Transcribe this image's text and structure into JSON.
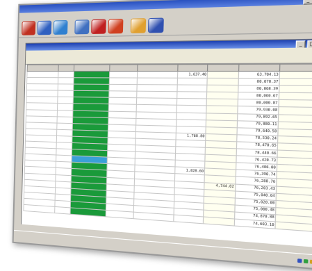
{
  "window": {
    "title": "",
    "controls": [
      "_",
      "□",
      "×"
    ]
  },
  "menubar": {
    "items": []
  },
  "toolbar": {
    "icons": [
      {
        "name": "app-icon",
        "color": "#c03020"
      },
      {
        "name": "document-icon",
        "color": "#3060c0"
      },
      {
        "name": "refresh-icon",
        "color": "#3080d0"
      },
      {
        "name": "report-icon",
        "color": "#4070c0"
      },
      {
        "name": "tools-icon",
        "color": "#c02020"
      },
      {
        "name": "stop-icon",
        "color": "#d04020"
      },
      {
        "name": "edit-icon",
        "color": "#e0a030"
      },
      {
        "name": "help-icon",
        "color": "#3050b0"
      }
    ]
  },
  "child_window": {
    "title": "",
    "menu": [],
    "toolbar": []
  },
  "table": {
    "columns": [
      "",
      "",
      "",
      "",
      "",
      "",
      "",
      "",
      ""
    ],
    "rows": [
      {
        "date": "",
        "code": "",
        "g": "",
        "d2": "",
        "desc": "",
        "amt": "1,637.40",
        "a2": "",
        "bal": "63,704.13",
        "x": ""
      },
      {
        "date": "",
        "code": "",
        "g": "",
        "d2": "",
        "desc": "",
        "amt": "",
        "a2": "",
        "bal": "80,078.37",
        "x": ""
      },
      {
        "date": "",
        "code": "",
        "g": "",
        "d2": "",
        "desc": "",
        "amt": "",
        "a2": "",
        "bal": "80,068.39",
        "x": ""
      },
      {
        "date": "",
        "code": "",
        "g": "",
        "d2": "",
        "desc": "",
        "amt": "",
        "a2": "",
        "bal": "80,060.67",
        "x": ""
      },
      {
        "date": "",
        "code": "",
        "g": "",
        "d2": "",
        "desc": "",
        "amt": "",
        "a2": "",
        "bal": "80,000.87",
        "x": ""
      },
      {
        "date": "",
        "code": "",
        "g": "",
        "d2": "",
        "desc": "",
        "amt": "",
        "a2": "",
        "bal": "79,930.08",
        "x": ""
      },
      {
        "date": "",
        "code": "",
        "g": "",
        "d2": "",
        "desc": "",
        "amt": "",
        "a2": "",
        "bal": "79,892.65",
        "x": ""
      },
      {
        "date": "",
        "code": "",
        "g": "",
        "d2": "",
        "desc": "",
        "amt": "",
        "a2": "",
        "bal": "79,880.11",
        "x": ""
      },
      {
        "date": "",
        "code": "",
        "g": "",
        "d2": "",
        "desc": "",
        "amt": "",
        "a2": "",
        "bal": "79,640.58",
        "x": ""
      },
      {
        "date": "",
        "code": "",
        "g": "",
        "d2": "",
        "desc": "",
        "amt": "1,768.80",
        "a2": "",
        "bal": "78,530.24",
        "x": ""
      },
      {
        "date": "",
        "code": "",
        "g": "",
        "d2": "",
        "desc": "",
        "amt": "",
        "a2": "",
        "bal": "78,470.65",
        "x": ""
      },
      {
        "date": "",
        "code": "",
        "g": "",
        "d2": "",
        "desc": "",
        "amt": "",
        "a2": "",
        "bal": "78,440.66",
        "x": ""
      },
      {
        "date": "",
        "code": "",
        "g": "",
        "d2": "",
        "desc": "",
        "amt": "",
        "a2": "",
        "bal": "76,420.73",
        "x": ""
      },
      {
        "date": "",
        "code": "",
        "g": "",
        "d2": "",
        "desc": "",
        "amt": "",
        "a2": "",
        "bal": "76,406.00",
        "x": ""
      },
      {
        "date": "",
        "code": "",
        "g": "",
        "d2": "",
        "desc": "",
        "amt": "1,828.60",
        "a2": "",
        "bal": "76,390.74",
        "x": ""
      },
      {
        "date": "",
        "code": "",
        "g": "",
        "d2": "",
        "desc": "",
        "amt": "",
        "a2": "",
        "bal": "76,288.76",
        "x": ""
      },
      {
        "date": "",
        "code": "",
        "g": "",
        "d2": "",
        "desc": "",
        "amt": "",
        "a2": "4,744.02",
        "bal": "76,203.43",
        "x": ""
      },
      {
        "date": "",
        "code": "",
        "g": "",
        "d2": "",
        "desc": "",
        "amt": "",
        "a2": "",
        "bal": "75,040.04",
        "x": ""
      },
      {
        "date": "",
        "code": "",
        "g": "",
        "d2": "",
        "desc": "",
        "amt": "",
        "a2": "",
        "bal": "75,020.00",
        "x": ""
      },
      {
        "date": "",
        "code": "",
        "g": "",
        "d2": "",
        "desc": "",
        "amt": "",
        "a2": "",
        "bal": "75,000.48",
        "x": ""
      },
      {
        "date": "",
        "code": "",
        "g": "",
        "d2": "",
        "desc": "",
        "amt": "",
        "a2": "",
        "bal": "74,870.88",
        "x": ""
      },
      {
        "date": "",
        "code": "",
        "g": "",
        "d2": "",
        "desc": "",
        "amt": "",
        "a2": "",
        "bal": "74,603.10",
        "x": ""
      }
    ]
  },
  "status": {
    "text": ""
  },
  "taskbar": {
    "tasks": []
  }
}
